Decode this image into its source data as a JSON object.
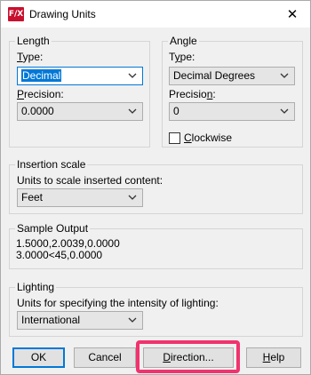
{
  "window": {
    "title": "Drawing Units",
    "app_icon_text": "F/X",
    "close_glyph": "✕"
  },
  "length": {
    "group_title": "Length",
    "type_label_accel": "T",
    "type_label_rest": "ype:",
    "type_value": "Decimal",
    "precision_label_accel": "P",
    "precision_label_rest": "recision:",
    "precision_value": "0.0000"
  },
  "angle": {
    "group_title": "Angle",
    "type_label_pre": "T",
    "type_label_accel": "y",
    "type_label_rest": "pe:",
    "type_value": "Decimal Degrees",
    "precision_label_pre": "Precisio",
    "precision_label_accel": "n",
    "precision_label_rest": ":",
    "precision_value": "0",
    "clockwise_accel": "C",
    "clockwise_rest": "lockwise",
    "clockwise_checked": false
  },
  "insertion": {
    "group_title": "Insertion scale",
    "label": "Units to scale inserted content:",
    "value": "Feet"
  },
  "sample": {
    "group_title": "Sample Output",
    "line1": "1.5000,2.0039,0.0000",
    "line2": "3.0000<45,0.0000"
  },
  "lighting": {
    "group_title": "Lighting",
    "label": "Units for specifying the intensity of lighting:",
    "value": "International"
  },
  "buttons": {
    "ok": "OK",
    "cancel": "Cancel",
    "direction_accel": "D",
    "direction_rest": "irection...",
    "help_accel": "H",
    "help_rest": "elp"
  },
  "colors": {
    "highlight": "#f0336e",
    "focus": "#0078d7"
  }
}
